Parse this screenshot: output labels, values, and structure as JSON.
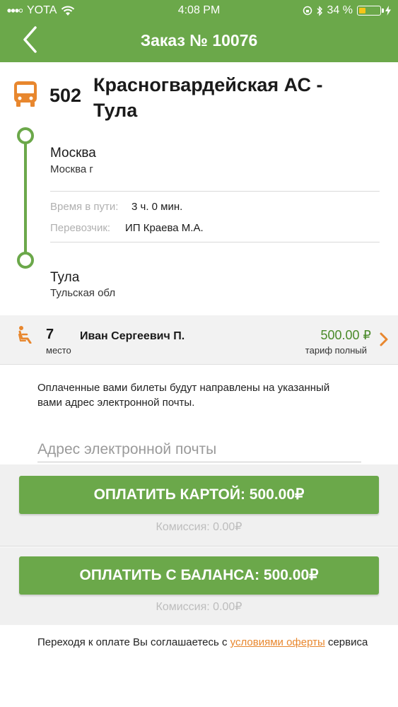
{
  "status_bar": {
    "carrier": "YOTA",
    "time": "4:08 PM",
    "battery": "34 %",
    "battery_level": 0.34
  },
  "nav": {
    "title": "Заказ № 10076"
  },
  "route": {
    "number": "502",
    "name": "Красногвардейская АС - Тула",
    "from_city": "Москва",
    "from_region": "Москва г",
    "duration_label": "Время в пути:",
    "duration_value": "3 ч. 0 мин.",
    "carrier_label": "Перевозчик:",
    "carrier_value": "ИП Краева М.А.",
    "to_city": "Тула",
    "to_region": "Тульская обл"
  },
  "ticket": {
    "seat": "7",
    "seat_label": "место",
    "passenger": "Иван Сергеевич П.",
    "price": "500.00 ₽",
    "tariff": "тариф полный"
  },
  "notice": "Оплаченные вами билеты будут направлены на указанный вами адрес электронной почты.",
  "email": {
    "placeholder": "Адрес электронной почты",
    "value": ""
  },
  "payment": {
    "card_button": "ОПЛАТИТЬ КАРТОЙ:   500.00₽",
    "card_commission": "Комиссия:   0.00₽",
    "balance_button": "ОПЛАТИТЬ С БАЛАНСА:  500.00₽",
    "balance_commission": "Комиссия:   0.00₽"
  },
  "footer": {
    "text_before": "Переходя к оплате Вы соглашаетесь с ",
    "link": "условиями оферты",
    "text_after": " сервиса"
  },
  "colors": {
    "brand_green": "#6ba84a",
    "accent_orange": "#e8872e",
    "price_green": "#4a8a2a"
  },
  "icons": {
    "back": "chevron-left-icon",
    "bus": "bus-icon",
    "seat": "seat-icon",
    "ticket_arrow": "chevron-right-icon"
  }
}
